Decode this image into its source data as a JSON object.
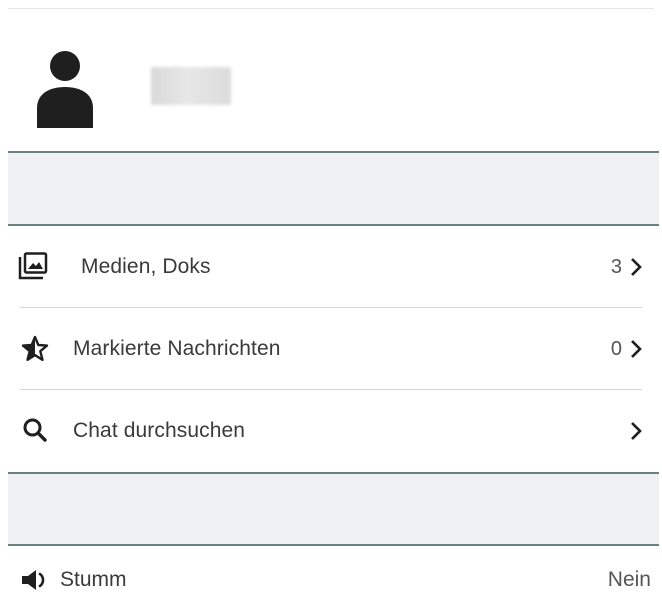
{
  "contact": {
    "name": "",
    "avatar_icon": "person-icon"
  },
  "menu": {
    "items": [
      {
        "label": "Medien, Doks",
        "count": "3",
        "icon": "media-icon"
      },
      {
        "label": "Markierte Nachrichten",
        "count": "0",
        "icon": "star-icon"
      },
      {
        "label": "Chat durchsuchen",
        "count": "",
        "icon": "search-icon"
      }
    ]
  },
  "mute": {
    "label": "Stumm",
    "value": "Nein",
    "icon": "speaker-icon"
  },
  "colors": {
    "divider_fill": "#eff0f1",
    "divider_border": "#6b8080",
    "icon": "#1f1f1f",
    "text": "#3a3a3a"
  }
}
